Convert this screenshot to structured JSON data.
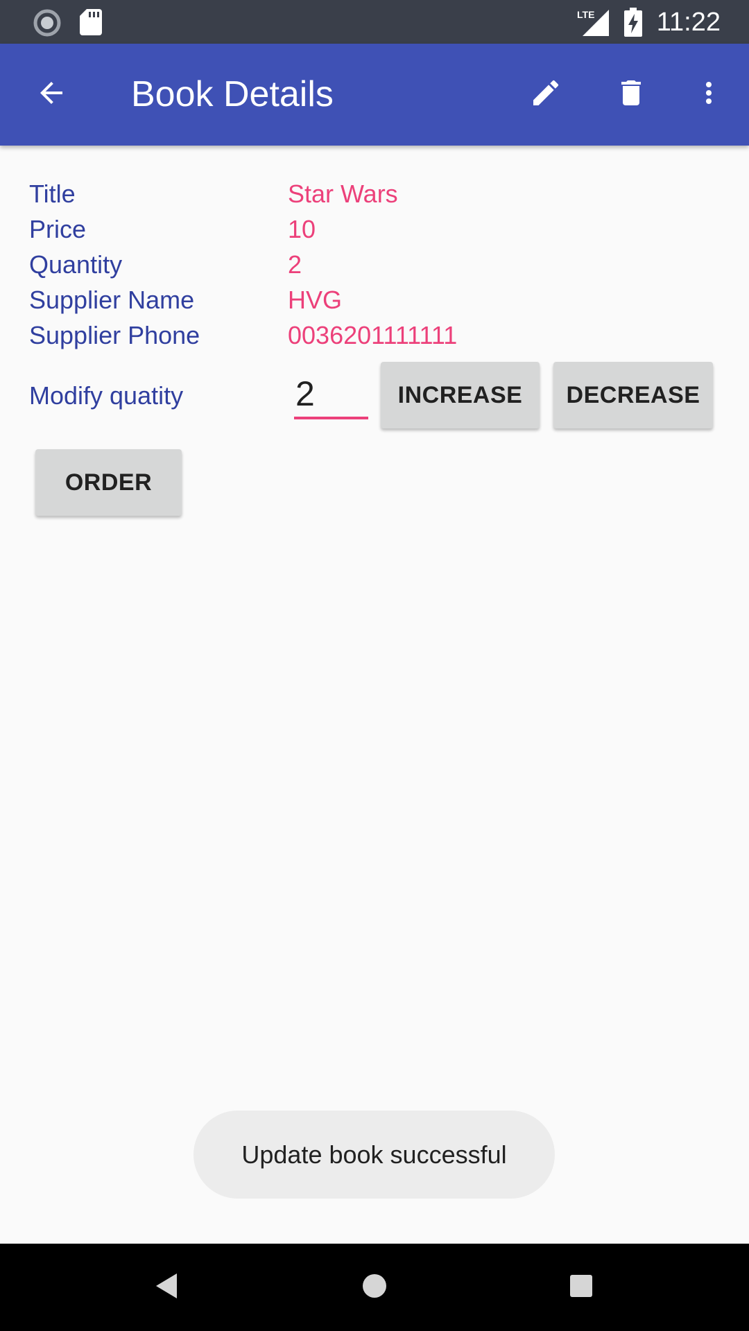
{
  "status_bar": {
    "time": "11:22",
    "network": "LTE",
    "left_icons": [
      "sync-icon",
      "sd-card-icon"
    ],
    "right_icons": [
      "signal-icon",
      "battery-charging-icon"
    ]
  },
  "app_bar": {
    "title": "Book Details",
    "icons": [
      "back-arrow-icon",
      "edit-icon",
      "delete-icon",
      "more-vert-icon"
    ],
    "color": "#3f51b5"
  },
  "details": [
    {
      "label": "Title",
      "value": "Star Wars"
    },
    {
      "label": "Price",
      "value": "10"
    },
    {
      "label": "Quantity",
      "value": "2"
    },
    {
      "label": "Supplier Name",
      "value": "HVG"
    },
    {
      "label": "Supplier Phone",
      "value": "0036201111111"
    }
  ],
  "modify": {
    "label": "Modify quatity",
    "input_value": "2",
    "increase_label": "INCREASE",
    "decrease_label": "DECREASE"
  },
  "order_label": "ORDER",
  "toast": "Update book successful",
  "colors": {
    "label": "#303f9f",
    "value": "#ec407a",
    "button": "#d6d7d7"
  }
}
